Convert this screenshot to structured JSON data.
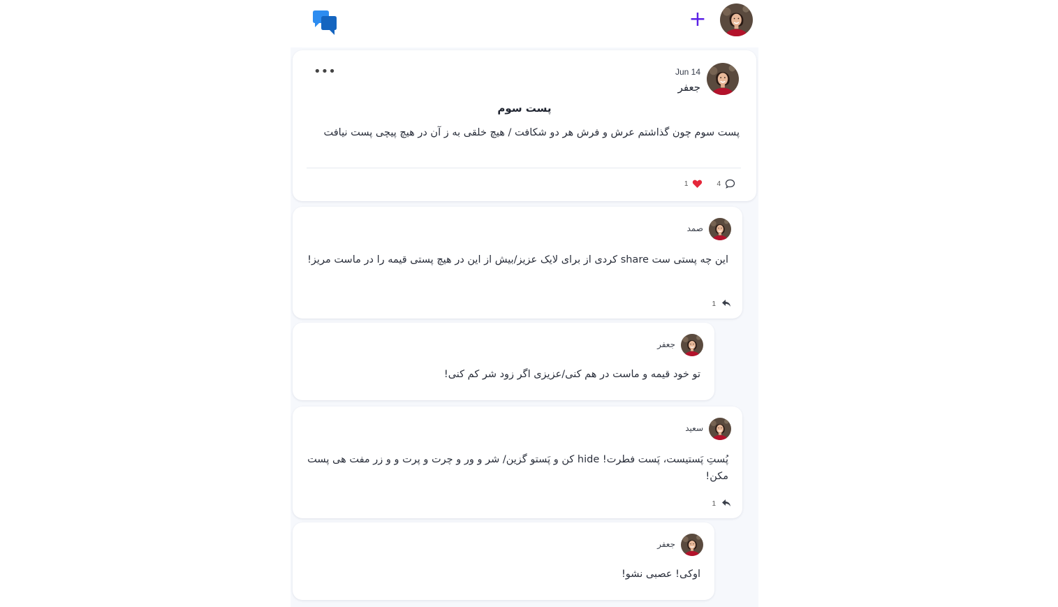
{
  "header": {
    "logo_icon": "chat-bubbles-icon",
    "add_icon": "plus-icon",
    "add_label": "+",
    "accent_color": "#5b21e6",
    "logo_color": "#1f7be6"
  },
  "post": {
    "date": "Jun 14",
    "author": "جعفر",
    "more_label": "•••",
    "title": "پست سوم",
    "body": "پست سوم چون گذاشتم عرش و فرش هر دو شکافت / هیچ خلقی به ز آن در هیچ پیچی پست نیافت",
    "comments_count": "4",
    "likes_count": "1",
    "like_color": "#e5273a"
  },
  "comments": [
    {
      "author": "صمد",
      "body": "این چه پستی ست share کردی از برای لایک عزیز/بیش از این در هیچ پستی قیمه را در ماست مریز!",
      "replies": "1"
    },
    {
      "author": "جعفر",
      "body": "تو خود قیمه و ماست در هم کنی/عزیزی اگر زود شر کم کنی!"
    },
    {
      "author": "سعید",
      "body": "پُستِ پَستیست، پَست فطرت! hide کن و پَستو گزین/ شر و ور و چرت و پرت و و زر مفت هی پست مکن!",
      "replies": "1"
    },
    {
      "author": "جعفر",
      "body": "اوکی! عصبی نشو!"
    }
  ]
}
